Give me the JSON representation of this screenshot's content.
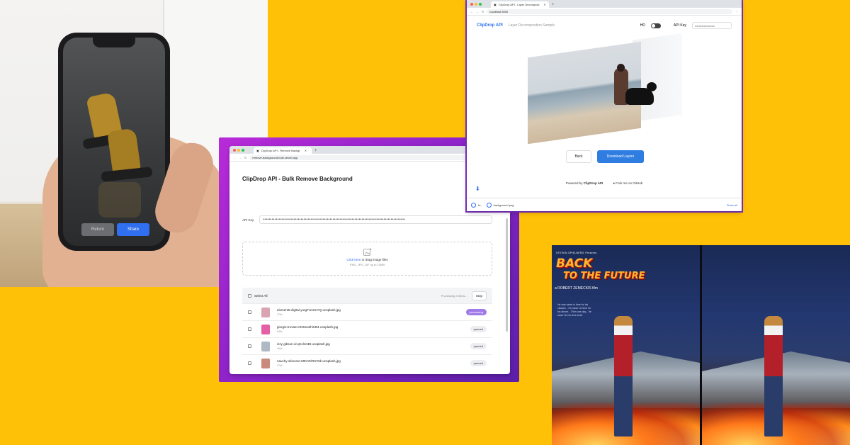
{
  "phone_demo": {
    "return_label": "Return",
    "share_label": "Share"
  },
  "bulk_window": {
    "tab_title": "ClipDrop API - Remove Backgr",
    "url": "remove-background-bulk.vercel.app",
    "heading": "ClipDrop API - Bulk Remove Background",
    "api_key_label": "API Key",
    "api_key_value": "••••••••••••••••••••••••••••••••••••••••••••••••••••••••••••••••••••••••••••••••••••••••••••••••••",
    "dropzone": {
      "link": "Click here",
      "text": " or drag image files",
      "hint": "PNG, JPG, GIF up to 10MB"
    },
    "select_all": "Select All",
    "status": "Processing 4 items...",
    "stop_label": "Stop",
    "files": [
      {
        "name": "element5-digital-yurgFvmHeYQ-unsplash.jpg",
        "size": "37kb",
        "status": "processing",
        "thumb": "#d9a3b2"
      },
      {
        "name": "giorgio-trovato-0CZwuZhiCB4-unsplash.jpg",
        "size": "83kb",
        "status": "queued",
        "thumb": "#e45fa6"
      },
      {
        "name": "izzy-gibson-ul-qKclcmBI-unsplash.jpg",
        "size": "46kb",
        "status": "queued",
        "thumb": "#aeb9c4"
      },
      {
        "name": "nauchy-skincare-M8VIS/RSV5k-unsplash.jpg",
        "size": "37kb",
        "status": "queued",
        "thumb": "#c98a7b"
      }
    ]
  },
  "layer_window": {
    "tab_title": "ClipDrop API - Layer Decomposi",
    "url": "localhost:3000",
    "brand": "ClipDrop API",
    "subtitle": "Layer Decomposition Sample",
    "hd_label": "HD",
    "api_key_label": "API Key",
    "api_key_value": "••••••••••••••••••••",
    "back_label": "Back",
    "download_label": "Download Layers",
    "powered_by": "Powered by",
    "powered_brand": "ClipDrop API",
    "github_label": "Fork me on GitHub",
    "downloads": [
      "fo...",
      "background.png"
    ],
    "show_all": "Show all"
  },
  "posters": {
    "presenter": "STEVEN SPIELBERG",
    "presents": "Presents",
    "title_line1": "BACK",
    "title_line2": "TO THE FUTURE",
    "director": "a ROBERT ZEMECKIS film",
    "tagline": "He was never in time for his classes... He wasn't in time for his dinner... Then one day... he wasn't in his time at all."
  }
}
